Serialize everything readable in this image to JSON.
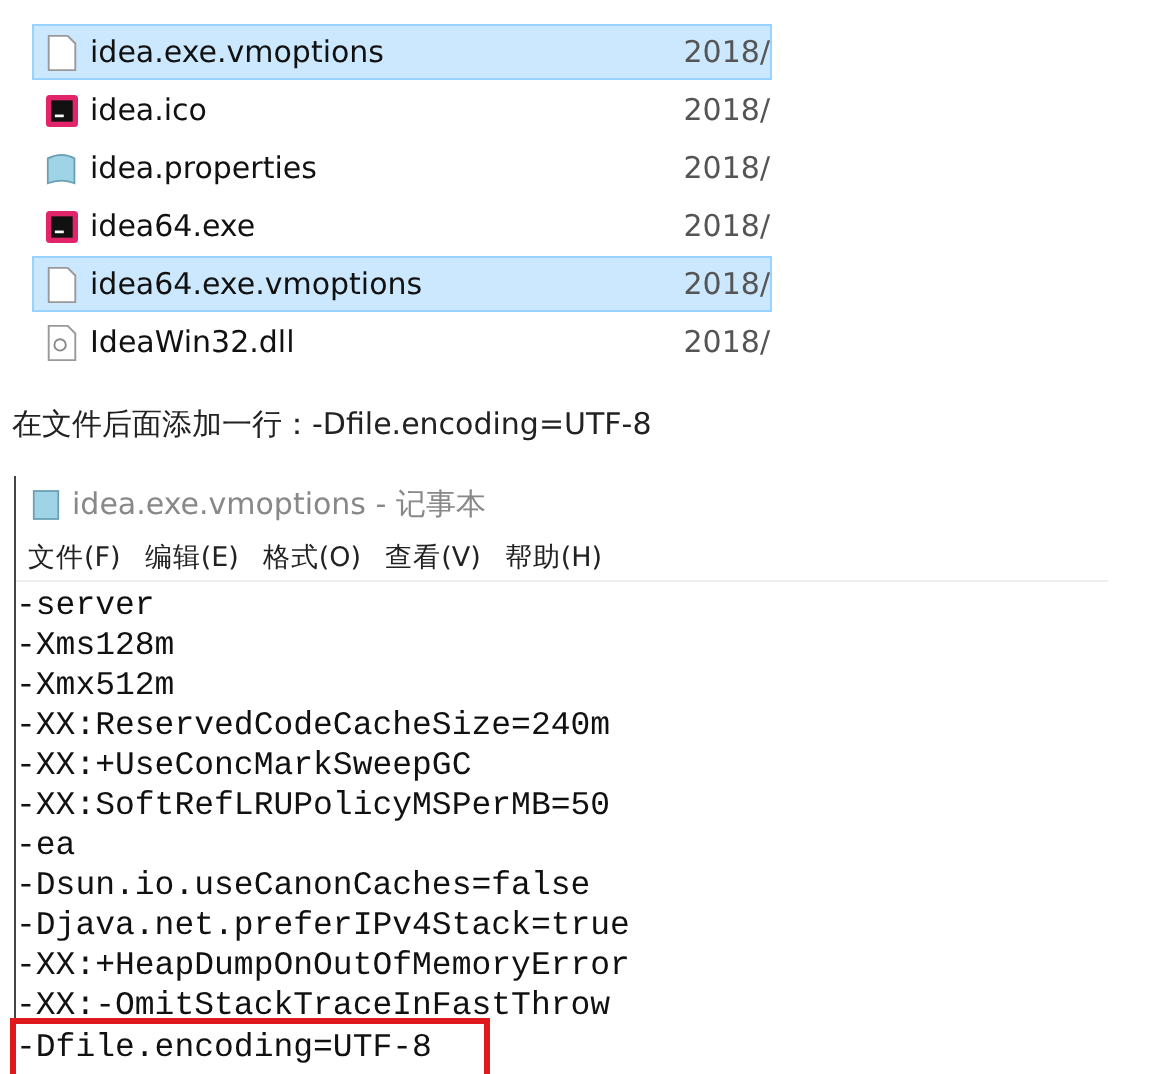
{
  "files": [
    {
      "name": "idea.exe.vmoptions",
      "date": "2018/",
      "kind": "text",
      "selected": true
    },
    {
      "name": "idea.ico",
      "date": "2018/",
      "kind": "app",
      "selected": false
    },
    {
      "name": "idea.properties",
      "date": "2018/",
      "kind": "properties",
      "selected": false
    },
    {
      "name": "idea64.exe",
      "date": "2018/",
      "kind": "app",
      "selected": false
    },
    {
      "name": "idea64.exe.vmoptions",
      "date": "2018/",
      "kind": "text",
      "selected": true
    },
    {
      "name": "IdeaWin32.dll",
      "date": "2018/",
      "kind": "dll",
      "selected": false
    }
  ],
  "caption": "在文件后面添加一行：-Dfile.encoding=UTF-8",
  "notepad": {
    "title": "idea.exe.vmoptions - 记事本",
    "menu": [
      "文件(F)",
      "编辑(E)",
      "格式(O)",
      "查看(V)",
      "帮助(H)"
    ],
    "lines": [
      {
        "text": "-server",
        "highlighted": false
      },
      {
        "text": "-Xms128m",
        "highlighted": false
      },
      {
        "text": "-Xmx512m",
        "highlighted": false
      },
      {
        "text": "-XX:ReservedCodeCacheSize=240m",
        "highlighted": false
      },
      {
        "text": "-XX:+UseConcMarkSweepGC",
        "highlighted": false
      },
      {
        "text": "-XX:SoftRefLRUPolicyMSPerMB=50",
        "highlighted": false
      },
      {
        "text": "-ea",
        "highlighted": false
      },
      {
        "text": "-Dsun.io.useCanonCaches=false",
        "highlighted": false
      },
      {
        "text": "-Djava.net.preferIPv4Stack=true",
        "highlighted": false
      },
      {
        "text": "-XX:+HeapDumpOnOutOfMemoryError",
        "highlighted": false
      },
      {
        "text": "-XX:-OmitStackTraceInFastThrow",
        "highlighted": false
      },
      {
        "text": "-Dfile.encoding=UTF-8",
        "highlighted": true
      }
    ]
  }
}
